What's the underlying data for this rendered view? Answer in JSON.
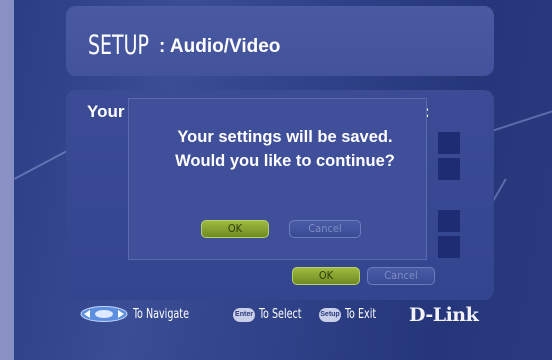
{
  "header": {
    "title": "SETUP",
    "subtitle": ": Audio/Video"
  },
  "content": {
    "left_label": "Your",
    "right_label": ":"
  },
  "dialog": {
    "line1": "Your settings will be saved.",
    "line2": "Would you like to continue?",
    "ok_label": "OK",
    "cancel_label": "Cancel"
  },
  "page_buttons": {
    "ok_label": "OK",
    "cancel_label": "Cancel"
  },
  "footer": {
    "navigate_text": "To Navigate",
    "enter_key": "Enter",
    "select_text": "To Select",
    "setup_key": "Setup",
    "exit_text": "To Exit",
    "brand": "D-Link"
  },
  "colors": {
    "accent_ok": "#8aa631",
    "background": "#2f4188"
  }
}
